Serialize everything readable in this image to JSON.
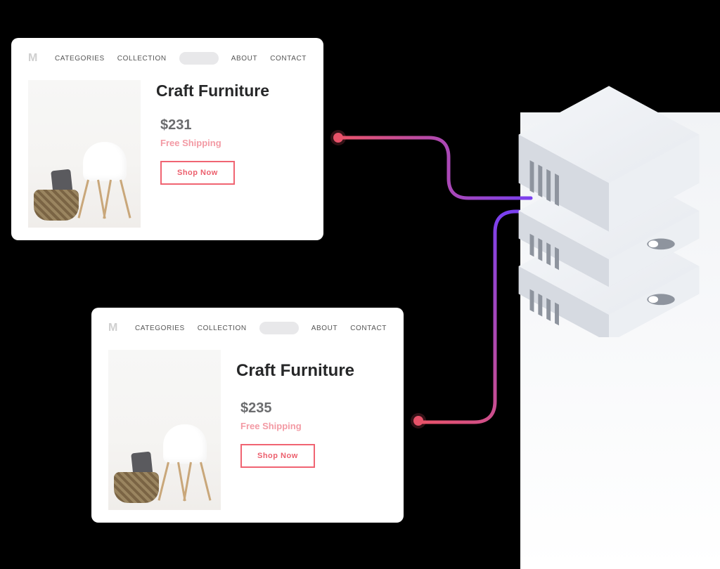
{
  "nav": {
    "logo": "M",
    "items": [
      "CATEGORIES",
      "COLLECTION",
      "ABOUT",
      "CONTACT"
    ]
  },
  "product": {
    "title": "Craft Furniture",
    "shipping": "Free Shipping",
    "cta": "Shop Now"
  },
  "cards": [
    {
      "price": "$231"
    },
    {
      "price": "$235"
    }
  ],
  "colors": {
    "accent": "#ec5f6d",
    "shipping": "#f39aa4",
    "gradientStart": "#e9536a",
    "gradientEnd": "#7a3ff0"
  }
}
